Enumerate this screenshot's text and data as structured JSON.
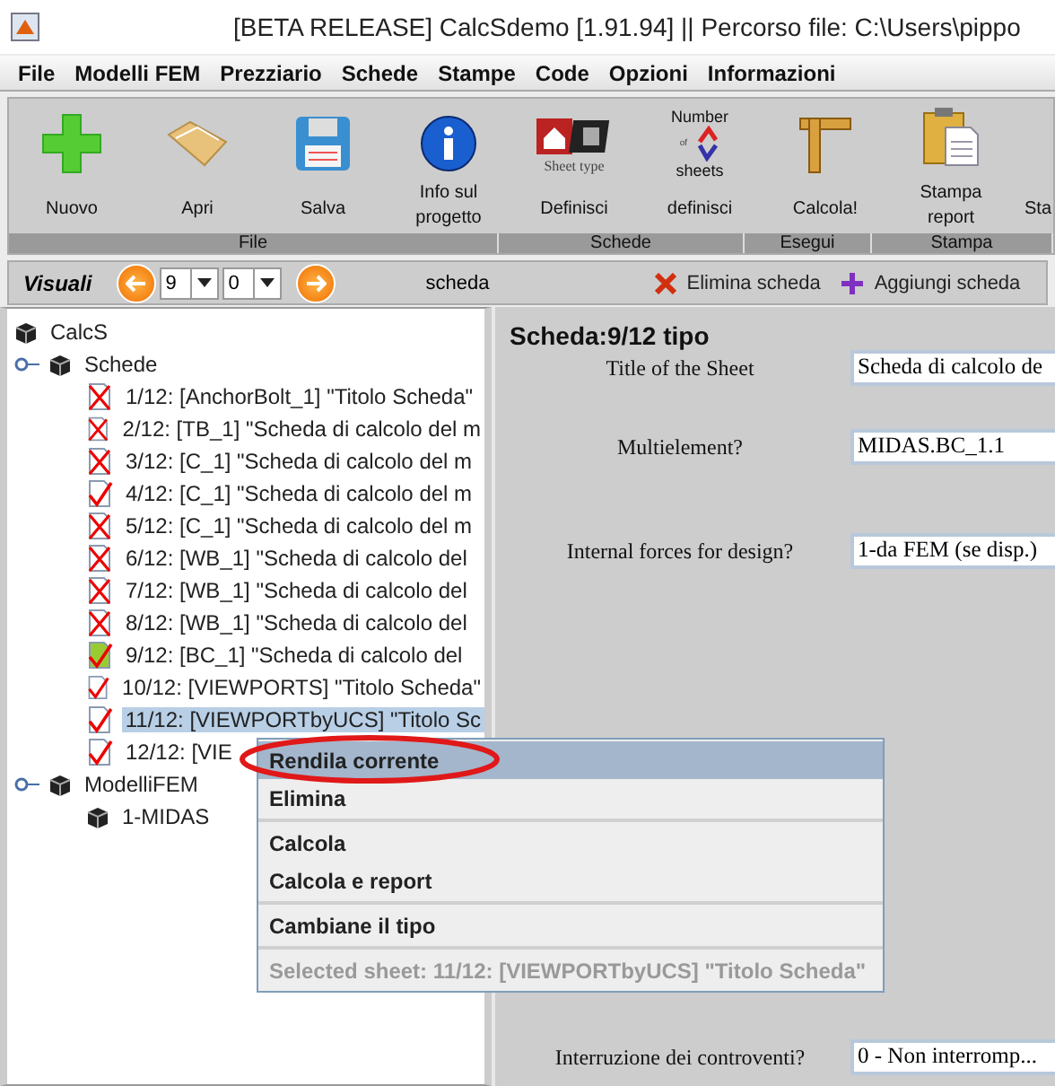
{
  "window": {
    "title": "[BETA RELEASE] CalcSdemo [1.91.94] || Percorso file: C:\\Users\\pippo"
  },
  "menu_bar": [
    "File",
    "Modelli FEM",
    "Prezziario",
    "Schede",
    "Stampe",
    "Code",
    "Opzioni",
    "Informazioni"
  ],
  "toolbar": {
    "buttons": [
      {
        "label": "Nuovo",
        "kind": "plus"
      },
      {
        "label": "Apri",
        "kind": "folder"
      },
      {
        "label": "Salva",
        "kind": "disk"
      },
      {
        "label": "Info sul progetto",
        "kind": "info"
      },
      {
        "label": "Definisci",
        "kind": "sheettype",
        "icon_texts": [
          "Sheet type"
        ]
      },
      {
        "label": "definisci",
        "kind": "numbersheets",
        "icon_texts": [
          "Number",
          "of",
          "sheets"
        ]
      },
      {
        "label": "Calcola!",
        "kind": "ruler"
      },
      {
        "label": "Stampa report",
        "kind": "clipboard"
      },
      {
        "label": "Sta",
        "kind": "partial"
      }
    ],
    "groups": [
      "File",
      "Schede",
      "Esegui",
      "Stampa"
    ]
  },
  "nav_bar": {
    "label": "Visuali",
    "spinners": [
      "9",
      "0"
    ],
    "caption": "scheda",
    "buttons": [
      {
        "label": "Elimina scheda",
        "kind": "delete"
      },
      {
        "label": "Aggiungi scheda",
        "kind": "add"
      }
    ]
  },
  "tree": {
    "label": "CalcS",
    "children": [
      {
        "label": "Schede",
        "expanded": true,
        "children": [
          {
            "label": "1/12: [AnchorBolt_1] \"Titolo Scheda\"",
            "kind": "error",
            "selected": false
          },
          {
            "label": "2/12: [TB_1] \"Scheda di calcolo del m",
            "kind": "error",
            "selected": false
          },
          {
            "label": "3/12: [C_1] \"Scheda di calcolo del m",
            "kind": "error",
            "selected": false
          },
          {
            "label": "4/12: [C_1] \"Scheda di calcolo del m",
            "kind": "ok",
            "selected": false
          },
          {
            "label": "5/12: [C_1] \"Scheda di calcolo del m",
            "kind": "error",
            "selected": false
          },
          {
            "label": "6/12: [WB_1] \"Scheda di calcolo del",
            "kind": "error",
            "selected": false
          },
          {
            "label": "7/12: [WB_1] \"Scheda di calcolo del",
            "kind": "error",
            "selected": false
          },
          {
            "label": "8/12: [WB_1] \"Scheda di calcolo del",
            "kind": "error",
            "selected": false
          },
          {
            "label": "9/12: [BC_1] \"Scheda di calcolo del",
            "kind": "current",
            "selected": false
          },
          {
            "label": "10/12: [VIEWPORTS] \"Titolo Scheda\"",
            "kind": "ok",
            "selected": false
          },
          {
            "label": "11/12: [VIEWPORTbyUCS] \"Titolo Sc",
            "kind": "ok",
            "selected": true
          },
          {
            "label": "12/12: [VIE",
            "kind": "ok",
            "selected": false
          }
        ]
      },
      {
        "label": "ModelliFEM",
        "expanded": true,
        "children": [
          {
            "label": "1-MIDAS",
            "kind": "model"
          }
        ]
      }
    ]
  },
  "sheet_form": {
    "heading": "Scheda:9/12 tipo",
    "rows": [
      {
        "label": "Title of the Sheet",
        "value": "Scheda di calcolo de"
      },
      {
        "label": "Multielement?",
        "value": "MIDAS.BC_1.1"
      },
      {
        "label": "Internal forces for design?",
        "value": "1-da FEM (se disp.)"
      },
      {
        "label": "Interruzione dei controventi?",
        "value": "0 - Non interromp..."
      }
    ]
  },
  "context_menu": {
    "sections": [
      [
        {
          "label": "Rendila corrente",
          "selected": true,
          "disabled": false
        },
        {
          "label": "Elimina",
          "selected": false,
          "disabled": false
        }
      ],
      [
        {
          "label": "Calcola",
          "selected": false,
          "disabled": false
        },
        {
          "label": "Calcola e report",
          "selected": false,
          "disabled": false
        }
      ],
      [
        {
          "label": "Cambiane il tipo",
          "selected": false,
          "disabled": false
        }
      ],
      [
        {
          "label": "Selected sheet: 11/12: [VIEWPORTbyUCS] \"Titolo Scheda\"",
          "selected": false,
          "disabled": true
        }
      ]
    ]
  }
}
